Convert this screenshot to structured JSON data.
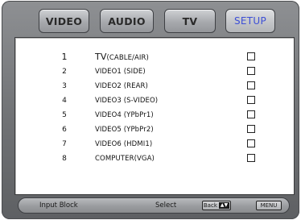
{
  "tabs": [
    {
      "label": "VIDEO",
      "active": false
    },
    {
      "label": "AUDIO",
      "active": false
    },
    {
      "label": "TV",
      "active": false
    },
    {
      "label": "SETUP",
      "active": true
    }
  ],
  "rows": [
    {
      "num": "1",
      "label_main": "TV",
      "label_rest": "(CABLE/AIR)",
      "checked": false
    },
    {
      "num": "2",
      "label": "VIDEO1 (SIDE)",
      "checked": false
    },
    {
      "num": "3",
      "label": "VIDEO2 (REAR)",
      "checked": false
    },
    {
      "num": "4",
      "label": "VIDEO3 (S-VIDEO)",
      "checked": false
    },
    {
      "num": "5",
      "label": "VIDEO4 (YPbPr1)",
      "checked": false
    },
    {
      "num": "6",
      "label": "VIDEO5 (YPbPr2)",
      "checked": false
    },
    {
      "num": "7",
      "label": "VIDEO6 (HDMI1)",
      "checked": false
    },
    {
      "num": "8",
      "label": "COMPUTER(VGA)",
      "checked": false
    }
  ],
  "footer": {
    "title": "Input Block",
    "select_label": "Select",
    "key_label": "Back",
    "key_arrows": "▲▼",
    "menu_label": "MENU"
  },
  "colors": {
    "frame": "#727477",
    "active_tab_text": "#3d4fd6",
    "panel": "#ffffff"
  }
}
